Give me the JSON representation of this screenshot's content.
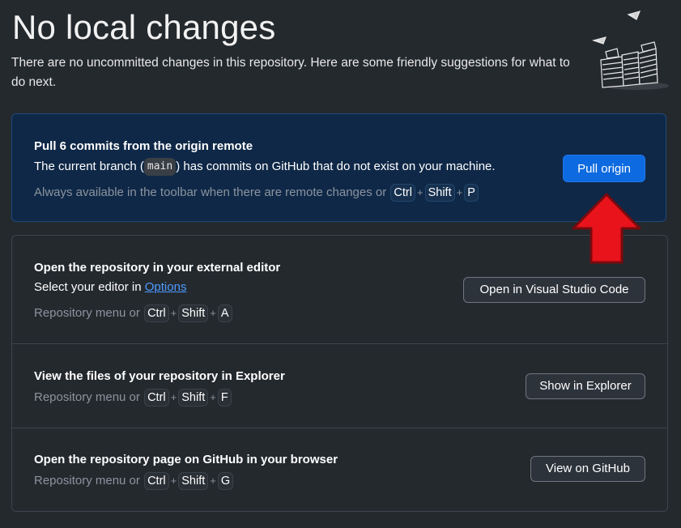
{
  "header": {
    "title": "No local changes",
    "subtitle": "There are no uncommitted changes in this repository. Here are some friendly suggestions for what to do next."
  },
  "pull": {
    "title": "Pull 6 commits from the origin remote",
    "desc_prefix": "The current branch (",
    "branch": "main",
    "desc_suffix": ") has commits on GitHub that do not exist on your machine.",
    "hint": "Always available in the toolbar when there are remote changes or",
    "keys": [
      "Ctrl",
      "Shift",
      "P"
    ],
    "button": "Pull origin"
  },
  "editor": {
    "title": "Open the repository in your external editor",
    "desc_prefix": "Select your editor in",
    "link": "Options",
    "hint": "Repository menu or",
    "keys": [
      "Ctrl",
      "Shift",
      "A"
    ],
    "button": "Open in Visual Studio Code"
  },
  "explorer": {
    "title": "View the files of your repository in Explorer",
    "hint": "Repository menu or",
    "keys": [
      "Ctrl",
      "Shift",
      "F"
    ],
    "button": "Show in Explorer"
  },
  "github": {
    "title": "Open the repository page on GitHub in your browser",
    "hint": "Repository menu or",
    "keys": [
      "Ctrl",
      "Shift",
      "G"
    ],
    "button": "View on GitHub"
  },
  "plus_symbol": "+",
  "colors": {
    "background": "#24292e",
    "primary_button": "#0d6ae0",
    "pull_card": "#0f2847",
    "link": "#4d9bff",
    "annotation_arrow": "#e8131b"
  },
  "icons": {
    "illustration": "paper-stacks-illustration-icon",
    "annotation": "red-up-arrow-icon"
  }
}
